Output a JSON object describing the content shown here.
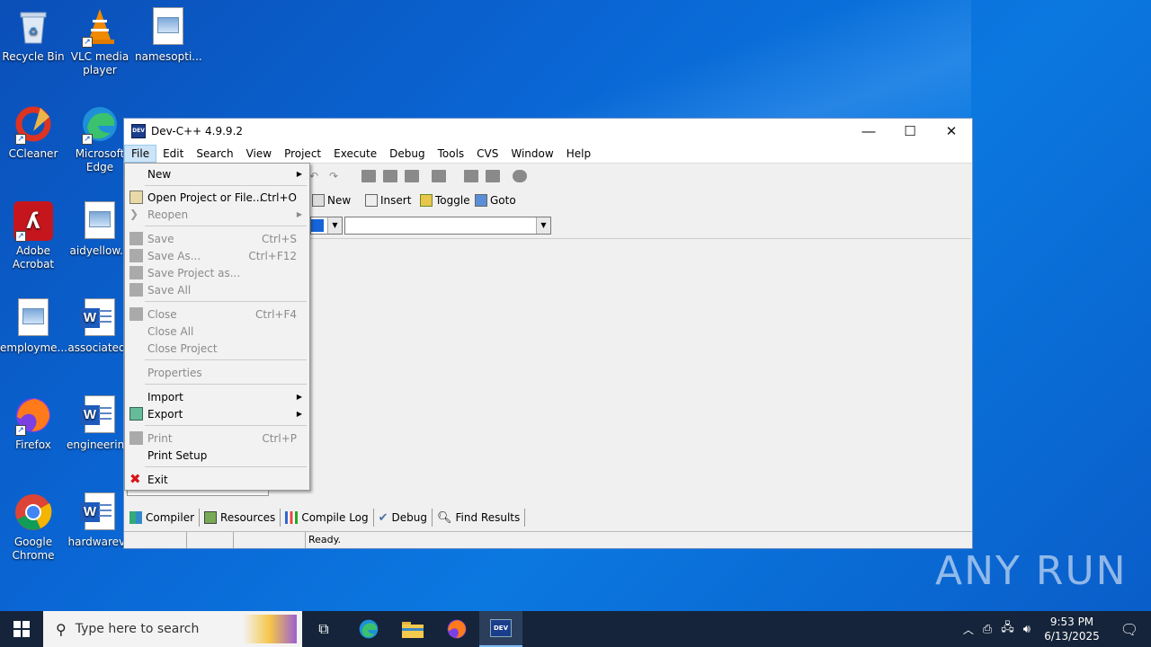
{
  "desktop": {
    "icons": [
      {
        "label": "Recycle Bin"
      },
      {
        "label": "VLC media player"
      },
      {
        "label": "namesopti..."
      },
      {
        "label": "CCleaner"
      },
      {
        "label": "Microsoft Edge"
      },
      {
        "label": "Adobe Acrobat"
      },
      {
        "label": "aidyellow..."
      },
      {
        "label": "employme..."
      },
      {
        "label": "associatedk"
      },
      {
        "label": "Firefox"
      },
      {
        "label": "engineerin..."
      },
      {
        "label": "Google Chrome"
      },
      {
        "label": "hardwareva"
      }
    ]
  },
  "window": {
    "title": "Dev-C++ 4.9.9.2",
    "menubar": [
      "File",
      "Edit",
      "Search",
      "View",
      "Project",
      "Execute",
      "Debug",
      "Tools",
      "CVS",
      "Window",
      "Help"
    ],
    "toolbar2": {
      "new": "New",
      "insert": "Insert",
      "toggle": "Toggle",
      "goto": "Goto"
    },
    "bottom_tabs": [
      "Compiler",
      "Resources",
      "Compile Log",
      "Debug",
      "Find Results"
    ],
    "status": "Ready."
  },
  "file_menu": {
    "items": [
      {
        "label": "New",
        "submenu": true,
        "disabled": false
      },
      {
        "label": "Open Project or File...",
        "shortcut": "Ctrl+O",
        "disabled": false
      },
      {
        "label": "Reopen",
        "submenu": true,
        "disabled": true
      },
      {
        "label": "Save",
        "shortcut": "Ctrl+S",
        "disabled": true
      },
      {
        "label": "Save As...",
        "shortcut": "Ctrl+F12",
        "disabled": true
      },
      {
        "label": "Save Project as...",
        "disabled": true
      },
      {
        "label": "Save All",
        "disabled": true
      },
      {
        "label": "Close",
        "shortcut": "Ctrl+F4",
        "disabled": true
      },
      {
        "label": "Close All",
        "disabled": true
      },
      {
        "label": "Close Project",
        "disabled": true
      },
      {
        "label": "Properties",
        "disabled": true
      },
      {
        "label": "Import",
        "submenu": true,
        "disabled": false
      },
      {
        "label": "Export",
        "submenu": true,
        "disabled": false
      },
      {
        "label": "Print",
        "shortcut": "Ctrl+P",
        "disabled": true
      },
      {
        "label": "Print Setup",
        "disabled": false
      },
      {
        "label": "Exit",
        "disabled": false
      }
    ]
  },
  "taskbar": {
    "search_placeholder": "Type here to search",
    "time": "9:53 PM",
    "date": "6/13/2025"
  },
  "watermark": "ANY RUN"
}
